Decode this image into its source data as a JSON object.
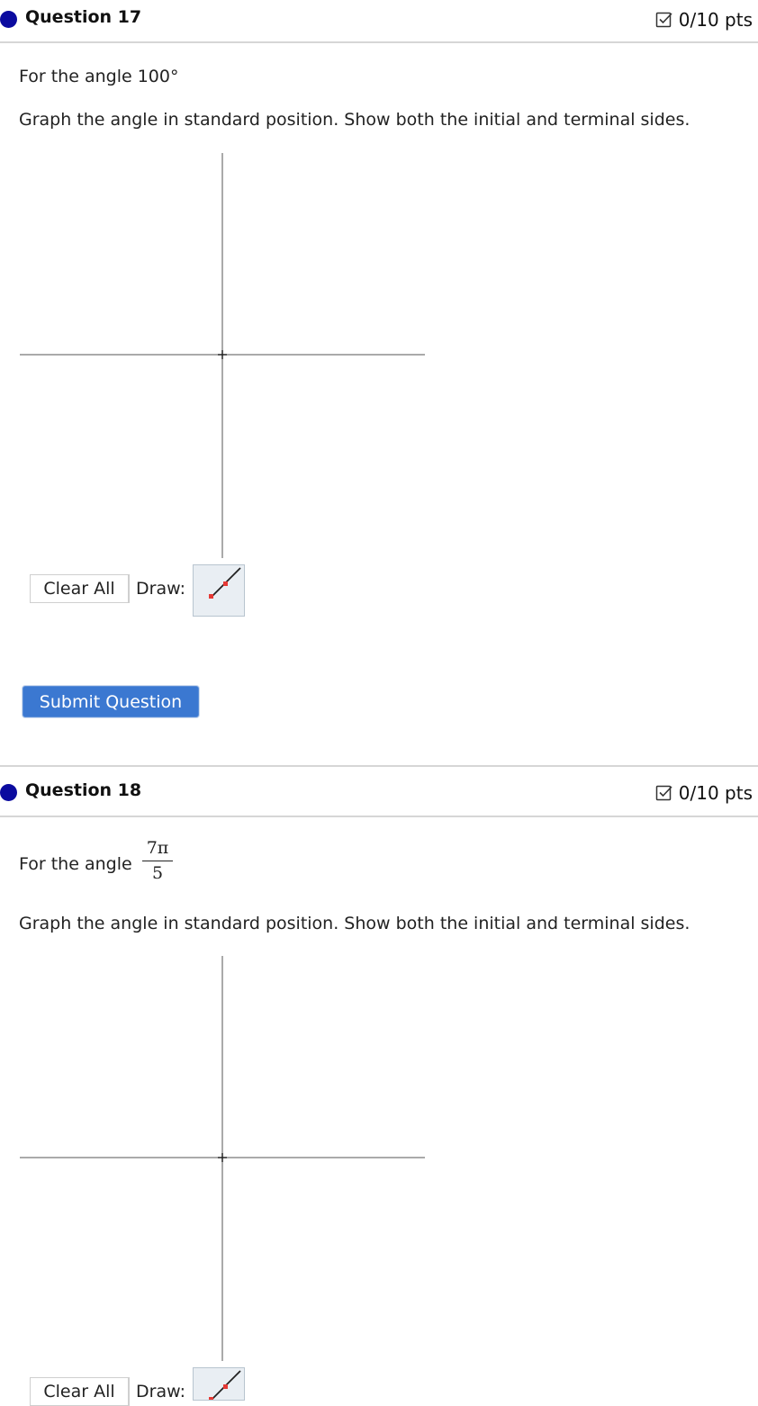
{
  "questions": [
    {
      "title": "Question 17",
      "points": "0/10 pts",
      "prompt_prefix": "For the angle 100°",
      "instruction": "Graph the angle in standard position. Show both the initial and terminal sides.",
      "clear_label": "Clear All",
      "draw_label": "Draw:"
    },
    {
      "title": "Question 18",
      "points": "0/10 pts",
      "prompt_prefix": "For the angle",
      "angle_numerator": "7π",
      "angle_denominator": "5",
      "instruction": "Graph the angle in standard position. Show both the initial and terminal sides.",
      "clear_label": "Clear All",
      "draw_label": "Draw:"
    }
  ],
  "submit_label": "Submit Question",
  "icons": {
    "status_dot": "question-status-dot",
    "points": "checkbox-check-icon",
    "draw_tool": "line-segment-icon"
  },
  "colors": {
    "status_dot": "#0b0b9f",
    "submit_bg": "#3b78d1",
    "draw_tool_endpoint": "#e53935"
  }
}
